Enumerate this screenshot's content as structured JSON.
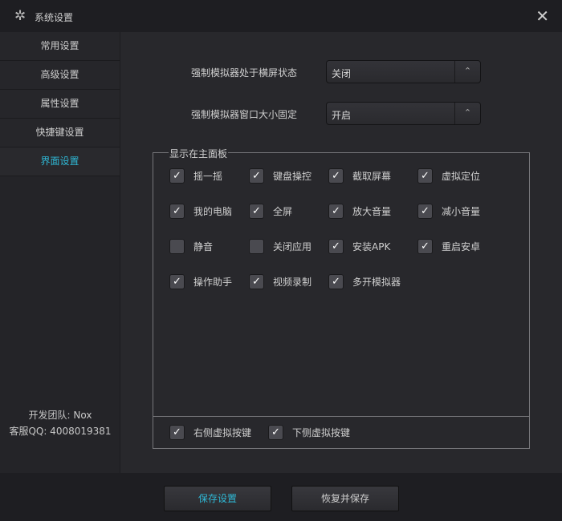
{
  "window": {
    "title": "系统设置",
    "close": "✕",
    "icon": "✲"
  },
  "sidebar": {
    "items": [
      {
        "label": "常用设置"
      },
      {
        "label": "高级设置"
      },
      {
        "label": "属性设置"
      },
      {
        "label": "快捷键设置"
      },
      {
        "label": "界面设置",
        "active": true
      }
    ],
    "team": "开发团队: Nox",
    "support": "客服QQ: 4008019381"
  },
  "settings": [
    {
      "label": "强制模拟器处于横屏状态",
      "value": "关闭"
    },
    {
      "label": "强制模拟器窗口大小固定",
      "value": "开启"
    }
  ],
  "group": {
    "title": "显示在主面板",
    "items": [
      {
        "label": "摇一摇",
        "checked": true
      },
      {
        "label": "键盘操控",
        "checked": true
      },
      {
        "label": "截取屏幕",
        "checked": true
      },
      {
        "label": "虚拟定位",
        "checked": true
      },
      {
        "label": "我的电脑",
        "checked": true
      },
      {
        "label": "全屏",
        "checked": true
      },
      {
        "label": "放大音量",
        "checked": true
      },
      {
        "label": "减小音量",
        "checked": true
      },
      {
        "label": "静音",
        "checked": false
      },
      {
        "label": "关闭应用",
        "checked": false
      },
      {
        "label": "安装APK",
        "checked": true
      },
      {
        "label": "重启安卓",
        "checked": true
      },
      {
        "label": "操作助手",
        "checked": true
      },
      {
        "label": "视频录制",
        "checked": true
      },
      {
        "label": "多开模拟器",
        "checked": true
      }
    ],
    "bottom": [
      {
        "label": "右侧虚拟按键",
        "checked": true
      },
      {
        "label": "下侧虚拟按键",
        "checked": true
      }
    ]
  },
  "footer": {
    "save": "保存设置",
    "restore": "恢复并保存"
  },
  "colors": {
    "accent": "#2fb9d6"
  }
}
